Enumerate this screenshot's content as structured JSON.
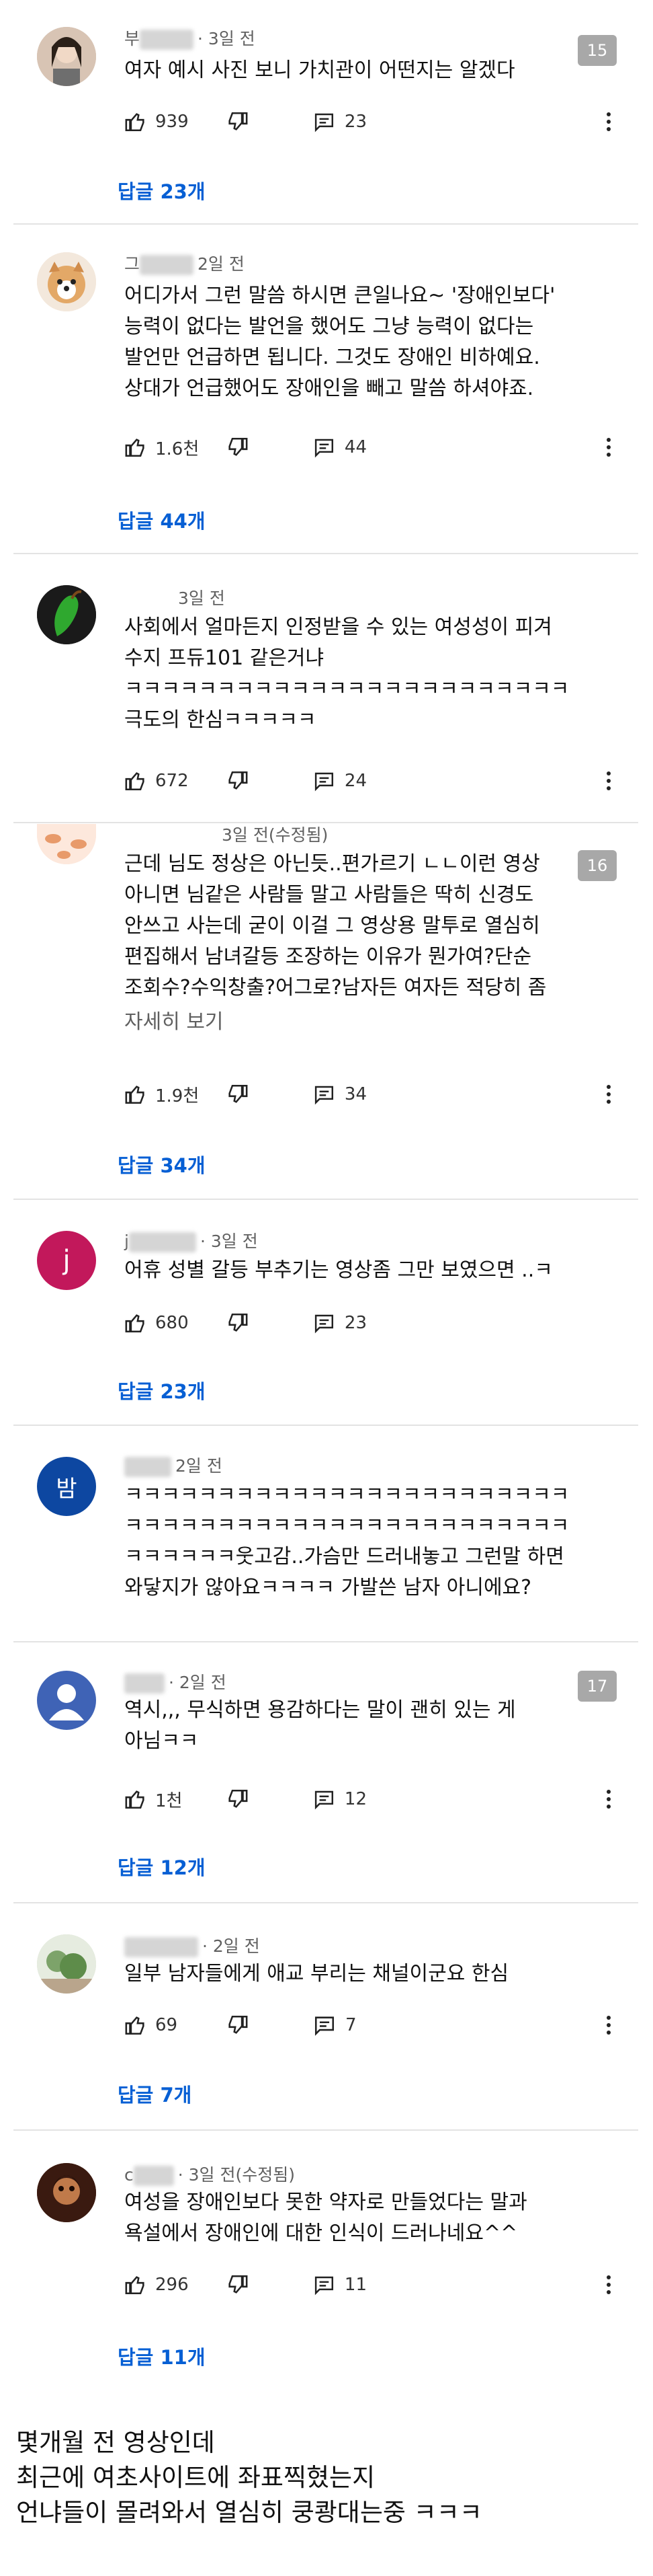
{
  "comments": [
    {
      "author": "부",
      "time": "3일 전",
      "text": "여자 예시 사진 보니 가치관이 어떤지는 알겠다",
      "likes": "939",
      "reply_count": "23",
      "badge": "15",
      "replies_link": "답글 23개"
    },
    {
      "author": "그",
      "time": "2일 전",
      "text": "어디가서 그런 말씀 하시면 큰일나요~ '장애인보다'\n능력이 없다는 발언을 했어도 그냥 능력이 없다는\n발언만 언급하면 됩니다. 그것도 장애인 비하예요.\n상대가 언급했어도 장애인을 빼고 말씀 하셔야죠.",
      "likes": "1.6천",
      "reply_count": "44",
      "replies_link": "답글 44개"
    },
    {
      "author": "",
      "time": "3일 전",
      "text": "사회에서 얼마든지 인정받을 수 있는 여성성이 피겨\n수지 프듀101 같은거냐\nㅋㅋㅋㅋㅋㅋㅋㅋㅋㅋㅋㅋㅋㅋㅋㅋㅋㅋㅋㅋㅋㅋㅋㅋ\n극도의 한심ㅋㅋㅋㅋㅋ",
      "likes": "672",
      "reply_count": "24"
    },
    {
      "author": "",
      "time": "3일 전(수정됨)",
      "text": "근데 님도 정상은 아닌듯..편가르기 ㄴㄴ이런 영상\n아니면 님같은 사람들 말고 사람들은 딱히 신경도\n안쓰고 사는데 굳이 이걸 그 영상용 말투로 열심히\n편집해서 남녀갈등 조장하는 이유가 뭔가여?단순\n조회수?수익창출?어그로?남자든 여자든 적당히 좀",
      "read_more": "자세히 보기",
      "likes": "1.9천",
      "reply_count": "34",
      "badge": "16",
      "replies_link": "답글 34개"
    },
    {
      "author": "j",
      "avatar_letter": "j",
      "time": "3일 전",
      "text": "어휴 성별 갈등 부추기는 영상좀 그만 보였으면 ..ㅋ",
      "likes": "680",
      "reply_count": "23",
      "replies_link": "답글 23개"
    },
    {
      "author": "",
      "avatar_letter": "밤",
      "time": "2일 전",
      "text": "ㅋㅋㅋㅋㅋㅋㅋㅋㅋㅋㅋㅋㅋㅋㅋㅋㅋㅋㅋㅋㅋㅋㅋㅋ\nㅋㅋㅋㅋㅋㅋㅋㅋㅋㅋㅋㅋㅋㅋㅋㅋㅋㅋㅋㅋㅋㅋㅋㅋ\nㅋㅋㅋㅋㅋㅋ웃고감..가슴만 드러내놓고 그런말 하면\n와닿지가 않아요ㅋㅋㅋㅋ 가발쓴 남자 아니에요?"
    },
    {
      "author": "",
      "time": "2일 전",
      "text": "역시,,, 무식하면 용감하다는 말이 괜히 있는 게\n아님ㅋㅋ",
      "likes": "1천",
      "reply_count": "12",
      "badge": "17",
      "replies_link": "답글 12개"
    },
    {
      "author": "",
      "time": "2일 전",
      "text": "일부 남자들에게 애교 부리는 채널이군요 한심",
      "likes": "69",
      "reply_count": "7",
      "replies_link": "답글 7개"
    },
    {
      "author": "c",
      "time": "3일 전(수정됨)",
      "text": "여성을 장애인보다 못한 약자로 만들었다는 말과\n욕설에서 장애인에 대한 인식이 드러나네요^^",
      "likes": "296",
      "reply_count": "11",
      "replies_link": "답글 11개"
    }
  ],
  "caption": "몇개월 전 영상인데\n최근에 여초사이트에 좌표찍혔는지\n언냐들이 몰려와서 열심히 쿵쾅대는중 ㅋㅋㅋ",
  "colors": {
    "link": "#065fd4",
    "avatar_j": "#c2185b",
    "avatar_bam": "#0d47a1",
    "avatar_default": "#3f63b6"
  }
}
